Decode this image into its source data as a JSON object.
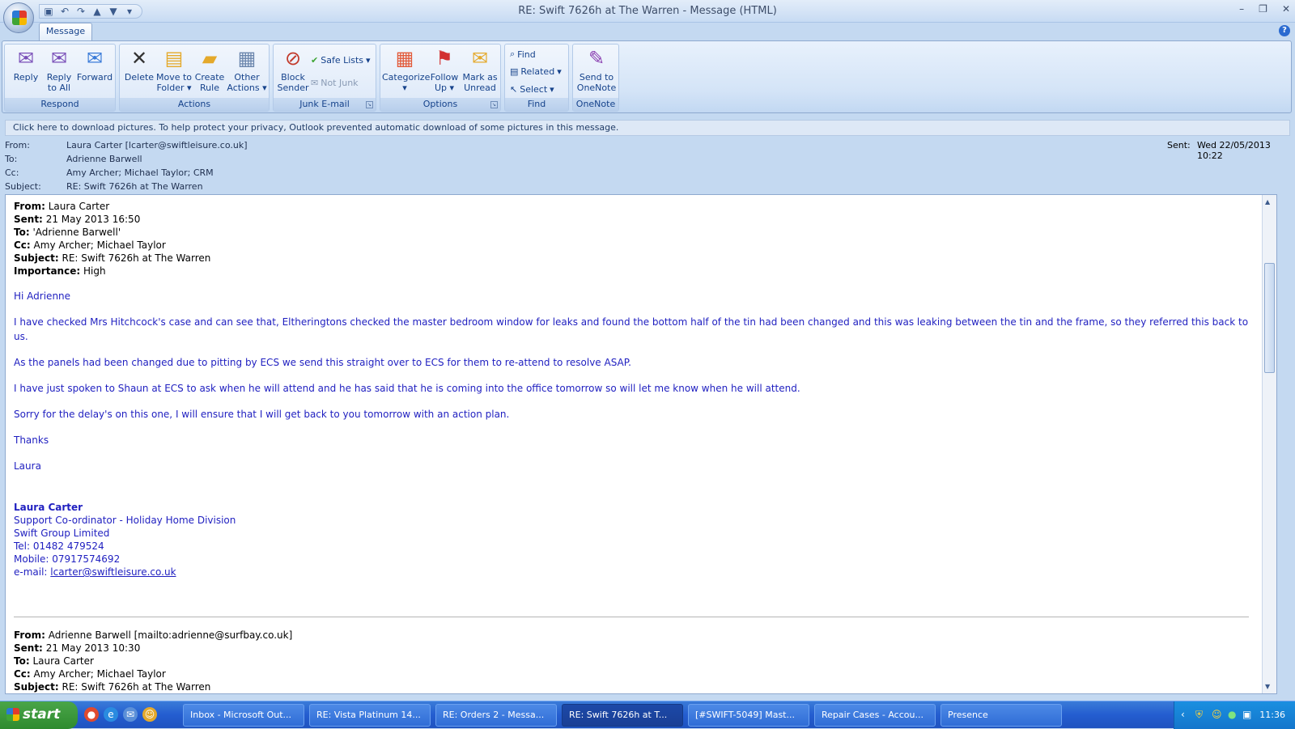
{
  "window": {
    "title": "RE: Swift 7626h at The Warren - Message (HTML)"
  },
  "ribbon": {
    "tab": "Message",
    "groups": {
      "respond": {
        "label": "Respond",
        "reply": "Reply",
        "reply_all_1": "Reply",
        "reply_all_2": "to All",
        "forward": "Forward"
      },
      "actions": {
        "label": "Actions",
        "delete": "Delete",
        "move_1": "Move to",
        "move_2": "Folder",
        "create_1": "Create",
        "create_2": "Rule",
        "other_1": "Other",
        "other_2": "Actions"
      },
      "junk": {
        "label": "Junk E-mail",
        "block_1": "Block",
        "block_2": "Sender",
        "safe_lists": "Safe Lists",
        "not_junk": "Not Junk"
      },
      "options": {
        "label": "Options",
        "categorize": "Categorize",
        "follow_1": "Follow",
        "follow_2": "Up",
        "mark_1": "Mark as",
        "mark_2": "Unread"
      },
      "find": {
        "label": "Find",
        "find": "Find",
        "related": "Related",
        "select": "Select"
      },
      "onenote": {
        "label": "OneNote",
        "send_1": "Send to",
        "send_2": "OneNote"
      }
    }
  },
  "infobar": "Click here to download pictures. To help protect your privacy, Outlook prevented automatic download of some pictures in this message.",
  "header": {
    "from_label": "From:",
    "from": "Laura Carter [lcarter@swiftleisure.co.uk]",
    "to_label": "To:",
    "to": "Adrienne Barwell",
    "cc_label": "Cc:",
    "cc": "Amy Archer; Michael Taylor; CRM",
    "subject_label": "Subject:",
    "subject": "RE: Swift 7626h at The Warren",
    "sent_label": "Sent:",
    "sent": "Wed 22/05/2013 10:22"
  },
  "message": {
    "from_label": "From:",
    "from": "Laura Carter",
    "sent_label": "Sent:",
    "sent": "21 May 2013 16:50",
    "to_label": "To:",
    "to": "'Adrienne Barwell'",
    "cc_label": "Cc:",
    "cc": "Amy Archer; Michael Taylor",
    "subject_label": "Subject:",
    "subject": "RE: Swift 7626h at The Warren",
    "importance_label": "Importance:",
    "importance": "High",
    "greeting": "Hi Adrienne",
    "p1": "I have checked Mrs Hitchcock's case and can see that, Eltheringtons checked the master bedroom window for leaks and found the bottom half of the tin had been changed and this was leaking between the tin and the frame, so they referred this back to us.",
    "p2": "As the panels had been changed due to pitting by ECS we send this straight over to ECS for them to re-attend to resolve ASAP.",
    "p3": "I have just spoken to Shaun at ECS to ask when he will attend and he has said that he is coming into the office tomorrow so will let me know when he will attend.",
    "p4": "Sorry for the delay's on this one, I will ensure that I will get back to you tomorrow with an action plan.",
    "thanks": "Thanks",
    "name": "Laura"
  },
  "signature": {
    "name": "Laura Carter",
    "role": "Support Co-ordinator - Holiday Home Division",
    "company": "Swift Group Limited",
    "tel": "Tel: 01482 479524",
    "mobile": "Mobile: 07917574692",
    "email_label": "e-mail: ",
    "email": "lcarter@swiftleisure.co.uk"
  },
  "previous": {
    "from_label": "From:",
    "from": "Adrienne Barwell [mailto:adrienne@surfbay.co.uk]",
    "sent_label": "Sent:",
    "sent": "21 May 2013 10:30",
    "to_label": "To:",
    "to": "Laura Carter",
    "cc_label": "Cc:",
    "cc": "Amy Archer; Michael Taylor",
    "subject_label": "Subject:",
    "subject": "RE: Swift 7626h at The Warren"
  },
  "taskbar": {
    "start": "start",
    "buttons": [
      "Inbox - Microsoft Out...",
      "RE: Vista Platinum 14...",
      "RE: Orders 2 - Messa...",
      "RE: Swift 7626h at T...",
      "[#SWIFT-5049] Mast...",
      "Repair Cases - Accou...",
      "Presence"
    ],
    "clock": "11:36"
  }
}
